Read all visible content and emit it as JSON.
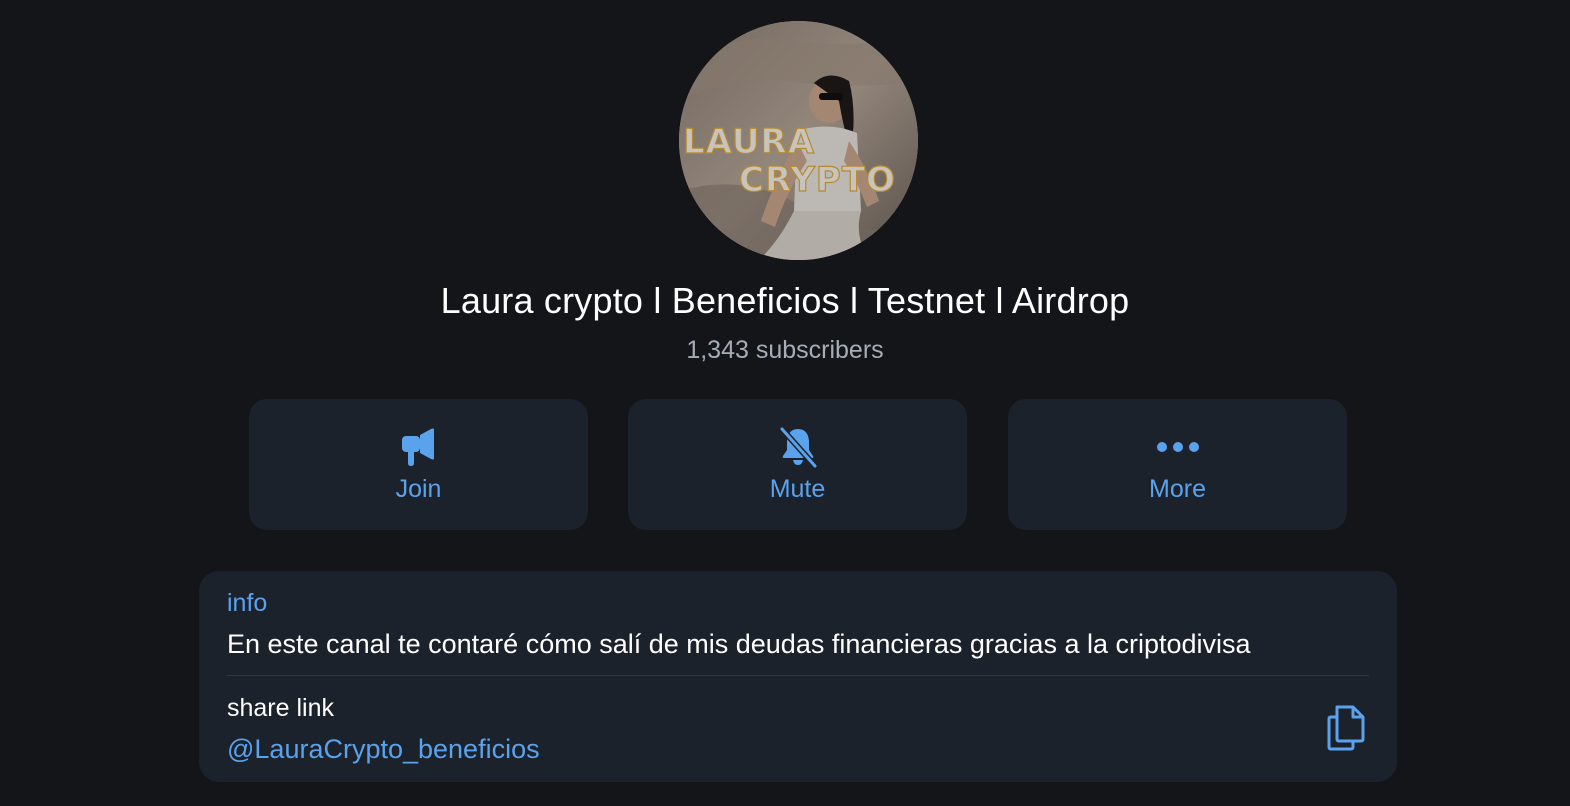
{
  "channel": {
    "title": "Laura crypto l Beneficios l Testnet l Airdrop",
    "subscribers": "1,343 subscribers",
    "avatar_text_line1": "LAURA",
    "avatar_text_line2": "CRYPTO"
  },
  "actions": [
    {
      "label": "Join",
      "icon": "megaphone-icon"
    },
    {
      "label": "Mute",
      "icon": "bell-off-icon"
    },
    {
      "label": "More",
      "icon": "more-dots-icon"
    }
  ],
  "info": {
    "label": "info",
    "text": "En este canal te contaré cómo salí de mis deudas financieras gracias a la criptodivisa"
  },
  "share": {
    "label": "share link",
    "link": "@LauraCrypto_beneficios",
    "copy_icon": "copy-icon"
  },
  "colors": {
    "background": "#131518",
    "card": "#1c222b",
    "accent": "#5aa2ec",
    "secondary_text": "#a6adb7"
  }
}
